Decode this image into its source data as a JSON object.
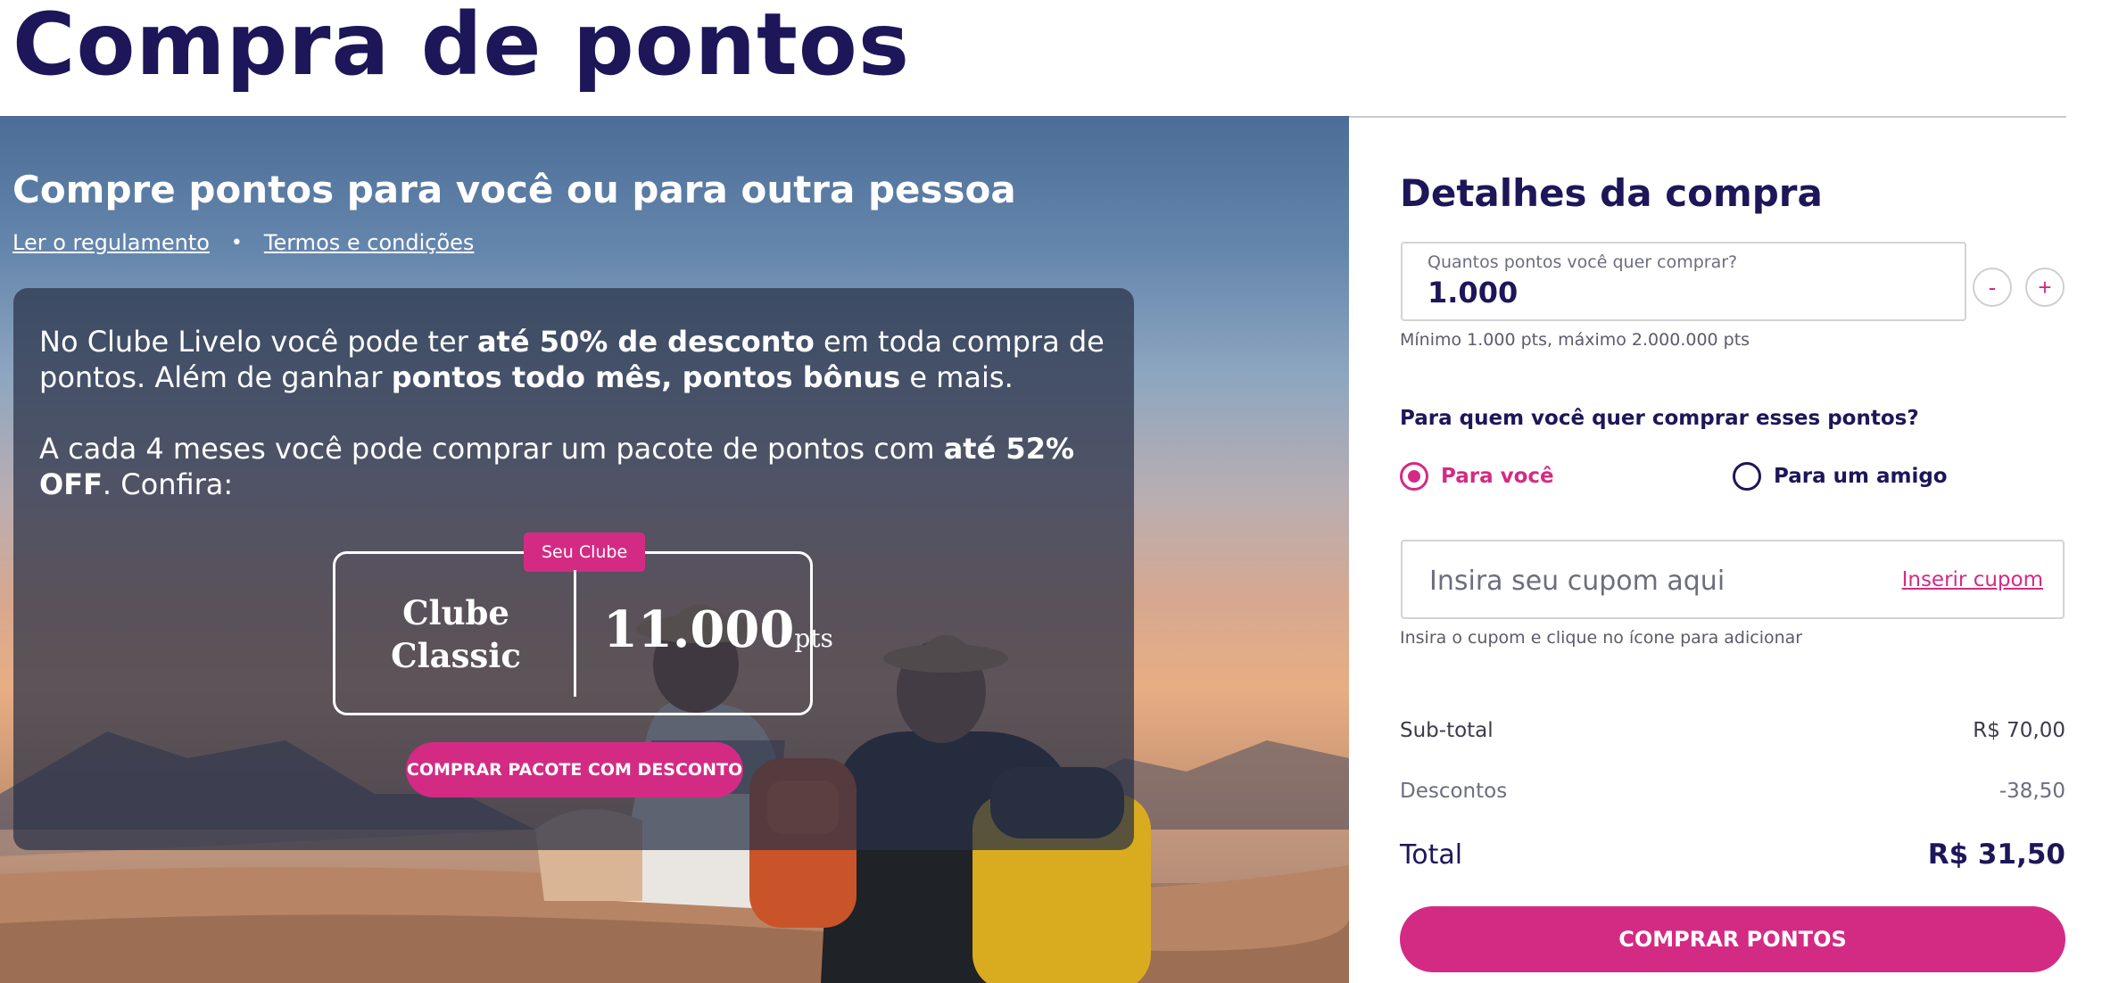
{
  "page": {
    "title": "Compra de pontos"
  },
  "hero": {
    "heading": "Compre pontos para você ou para outra pessoa",
    "link_regulation": "Ler o regulamento",
    "separator": "•",
    "link_terms": "Termos e condições",
    "promo": {
      "p1_a": "No Clube Livelo você pode ter ",
      "p1_b": "até 50% de desconto",
      "p1_c": " em toda compra de pontos. Além de ganhar ",
      "p1_d": "pontos todo mês, pontos bônus",
      "p1_e": " e mais.",
      "p2_a": "A cada 4 meses você pode comprar um pacote de pontos com ",
      "p2_b": "até 52% OFF",
      "p2_c": ". Confira:"
    },
    "plan": {
      "badge": "Seu Clube",
      "name_line1": "Clube",
      "name_line2": "Classic",
      "points": "11.000",
      "unit": "pts"
    },
    "promo_button": "COMPRAR PACOTE COM DESCONTO"
  },
  "panel": {
    "title": "Detalhes da compra",
    "quantity": {
      "label": "Quantos pontos você quer comprar?",
      "value": "1.000",
      "hint": "Mínimo 1.000 pts, máximo 2.000.000 pts",
      "minus": "-",
      "plus": "+"
    },
    "recipient": {
      "question": "Para quem você quer comprar esses pontos?",
      "option_you": "Para você",
      "option_friend": "Para um amigo",
      "selected": "Para você"
    },
    "coupon": {
      "placeholder": "Insira seu cupom aqui",
      "link": "Inserir cupom",
      "hint": "Insira o cupom e clique no ícone para adicionar"
    },
    "summary": {
      "subtotal_label": "Sub-total",
      "subtotal_value": "R$ 70,00",
      "discount_label": "Descontos",
      "discount_value": "-38,50",
      "total_label": "Total",
      "total_value": "R$ 31,50"
    },
    "buy_button": "COMPRAR PONTOS"
  },
  "colors": {
    "brand": "#d32b84",
    "navy": "#1d1659"
  }
}
